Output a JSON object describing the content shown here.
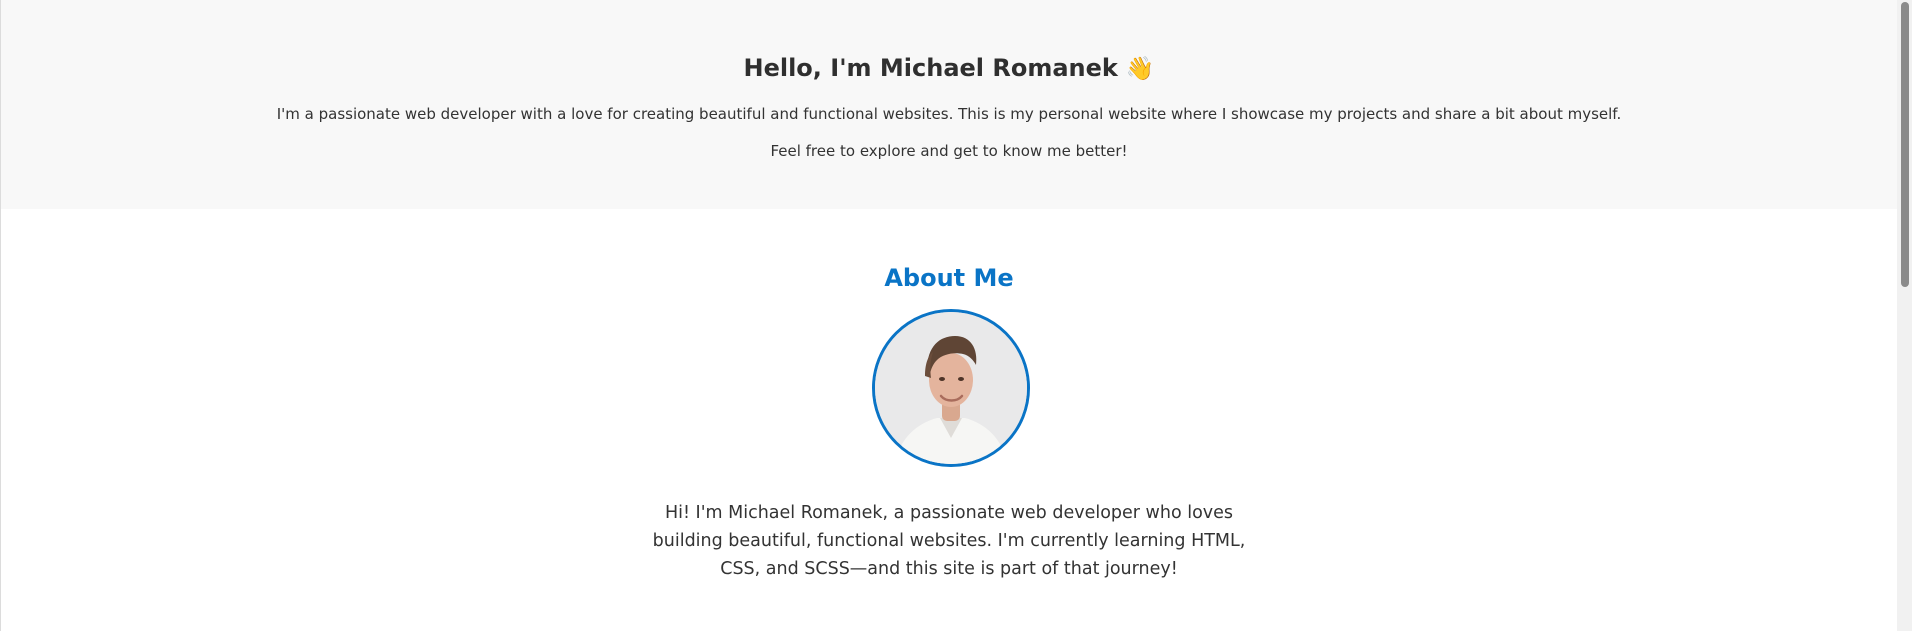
{
  "hero": {
    "title": "Hello, I'm Michael Romanek",
    "wave_emoji": "👋",
    "intro_line1": "I'm a passionate web developer with a love for creating beautiful and functional websites. This is my personal website where I showcase my projects and share a bit about myself.",
    "intro_line2": "Feel free to explore and get to know me better!"
  },
  "about": {
    "heading": "About Me",
    "photo_alt": "Michael Romanek",
    "bio": "Hi! I'm Michael Romanek, a passionate web developer who loves building beautiful, functional websites. I'm currently learning HTML, CSS, and SCSS—and this site is part of that journey!"
  },
  "colors": {
    "accent": "#0a74c6",
    "hero_background": "#f8f8f8",
    "text": "#333333"
  }
}
